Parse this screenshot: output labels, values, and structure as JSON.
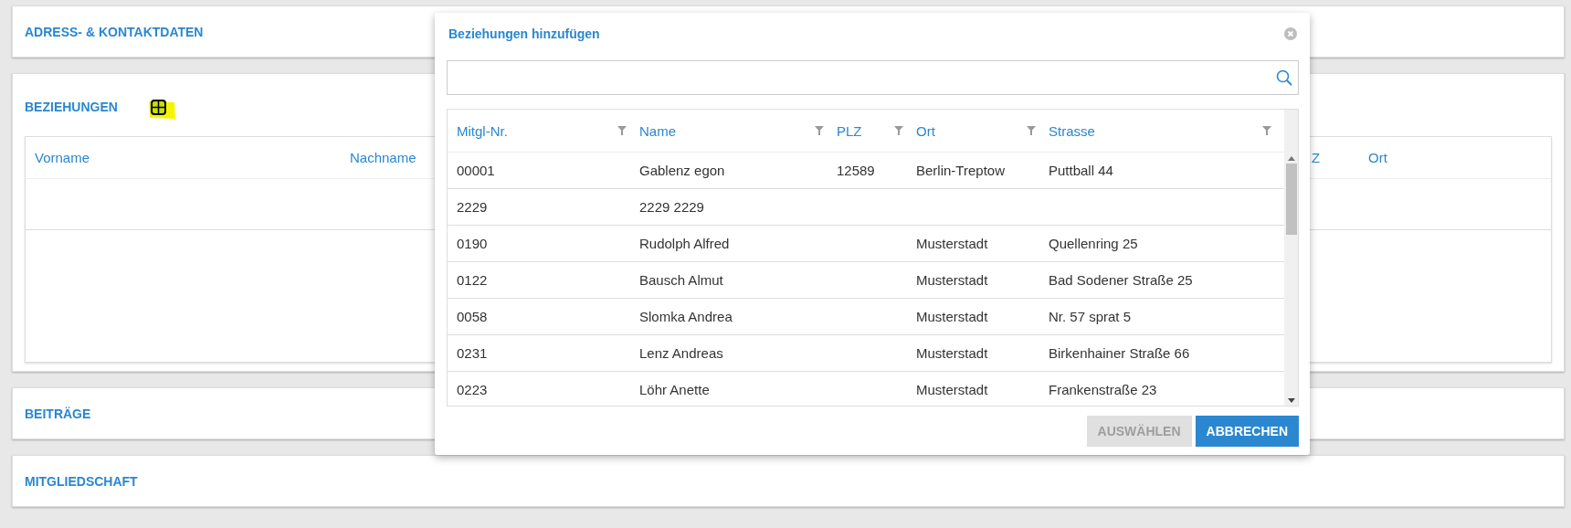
{
  "sections": [
    {
      "title": "ADRESS- & KONTAKTDATEN",
      "kind": "collapsed"
    },
    {
      "title": "BEZIEHUNGEN",
      "kind": "table",
      "add_button": true,
      "columns": [
        "Vorname",
        "Nachname",
        "Z",
        "Ort"
      ]
    },
    {
      "title": "BEITRÄGE",
      "kind": "collapsed"
    },
    {
      "title": "MITGLIEDSCHAFT",
      "kind": "collapsed"
    }
  ],
  "dialog": {
    "title": "Beziehungen hinzufügen",
    "columns": [
      "Mitgl-Nr.",
      "Name",
      "PLZ",
      "Ort",
      "Strasse"
    ],
    "rows": [
      [
        "00001",
        "Gablenz egon",
        "12589",
        "Berlin-Treptow",
        "Puttball 44"
      ],
      [
        "2229",
        "2229 2229",
        "",
        "",
        ""
      ],
      [
        "0190",
        "Rudolph Alfred",
        "",
        "Musterstadt",
        "Quellenring 25"
      ],
      [
        "0122",
        "Bausch Almut",
        "",
        "Musterstadt",
        "Bad Sodener Straße 25"
      ],
      [
        "0058",
        "Slomka Andrea",
        "",
        "Musterstadt",
        "Nr. 57 sprat 5"
      ],
      [
        "0231",
        "Lenz Andreas",
        "",
        "Musterstadt",
        "Birkenhainer Straße 66"
      ],
      [
        "0223",
        "Löhr Anette",
        "",
        "Musterstadt",
        "Frankenstraße 23"
      ]
    ],
    "buttons": [
      {
        "label": "AUSWÄHLEN",
        "disabled": true
      },
      {
        "label": "ABBRECHEN",
        "disabled": false
      }
    ]
  }
}
